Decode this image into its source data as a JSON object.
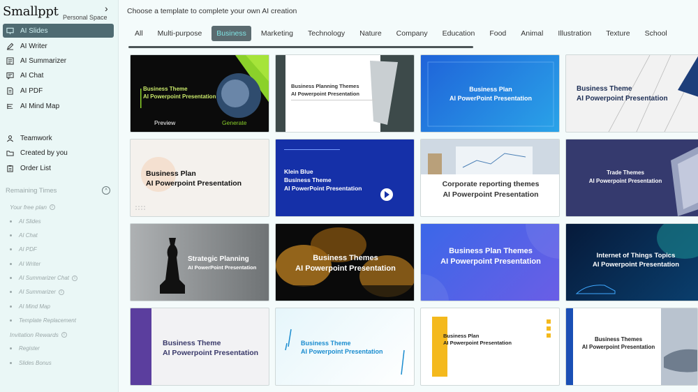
{
  "sidebar": {
    "brand": "Smallppt",
    "personal_space": "Personal Space",
    "nav": [
      {
        "label": "AI Slides",
        "icon": "slides-icon"
      },
      {
        "label": "AI Writer",
        "icon": "pen-icon"
      },
      {
        "label": "AI Summarizer",
        "icon": "summarizer-icon"
      },
      {
        "label": "AI Chat",
        "icon": "chat-icon"
      },
      {
        "label": "AI PDF",
        "icon": "pdf-icon"
      },
      {
        "label": "AI Mind Map",
        "icon": "mind-map-icon"
      }
    ],
    "secondary": [
      {
        "label": "Teamwork",
        "icon": "team-icon"
      },
      {
        "label": "Created by you",
        "icon": "folder-icon"
      },
      {
        "label": "Order List",
        "icon": "clipboard-icon"
      }
    ],
    "remaining_label": "Remaining Times",
    "free_plan_label": "Your free plan",
    "free_plan_items": [
      "AI Slides",
      "AI Chat",
      "AI PDF",
      "AI Writer",
      "AI Summarizer Chat",
      "AI Summarizer",
      "AI Mind Map",
      "Template Replacement"
    ],
    "invitation_label": "Invitation Rewards",
    "invitation_items": [
      "Register",
      "Slides Bonus"
    ]
  },
  "main": {
    "heading": "Choose a template to complete your own AI creation",
    "tabs": [
      "All",
      "Multi-purpose",
      "Business",
      "Marketing",
      "Technology",
      "Nature",
      "Company",
      "Education",
      "Food",
      "Animal",
      "Illustration",
      "Texture",
      "School"
    ],
    "active_tab": "Business",
    "card_actions": {
      "preview": "Preview",
      "generate": "Generate"
    },
    "cards": [
      {
        "l1": "Business Theme",
        "l2": "AI Powerpoint Presentation"
      },
      {
        "l1": "Business Planning Themes",
        "l2": "AI Powerpoint Presentation"
      },
      {
        "l1": "Business Plan",
        "l2": "AI PowerPoint Presentation"
      },
      {
        "l1": "Business Theme",
        "l2": "AI Powerpoint Presentation"
      },
      {
        "l1": "Business Plan",
        "l2": "AI Powerpoint Presentation"
      },
      {
        "l1": "Klein Blue",
        "l2": "Business Theme",
        "l3": "AI PowerPoint Presentation"
      },
      {
        "l1": "Corporate reporting themes",
        "l2": "AI Powerpoint Presentation"
      },
      {
        "l1": "Trade Themes",
        "l2": "AI Powerpoint Presentation"
      },
      {
        "l1": "Strategic Planning",
        "l2": "AI PowerPoint Presentation"
      },
      {
        "l1": "Business Themes",
        "l2": "AI Powerpoint Presentation"
      },
      {
        "l1": "Business Plan Themes",
        "l2": "AI Powerpoint Presentation"
      },
      {
        "l1": "Internet of Things Topics",
        "l2": "AI Powerpoint Presentation"
      },
      {
        "l1": "Business Theme",
        "l2": "AI Powerpoint Presentation"
      },
      {
        "l1": "Business Theme",
        "l2": "AI Powerpoint Presentation"
      },
      {
        "l1": "Business Plan",
        "l2": "AI Powerpoint Presentation"
      },
      {
        "l1": "Business Themes",
        "l2": "AI Powerpoint Presentation"
      }
    ]
  },
  "colors": {
    "accent": "#7fe3e3",
    "active_bg": "#4f6b72"
  }
}
